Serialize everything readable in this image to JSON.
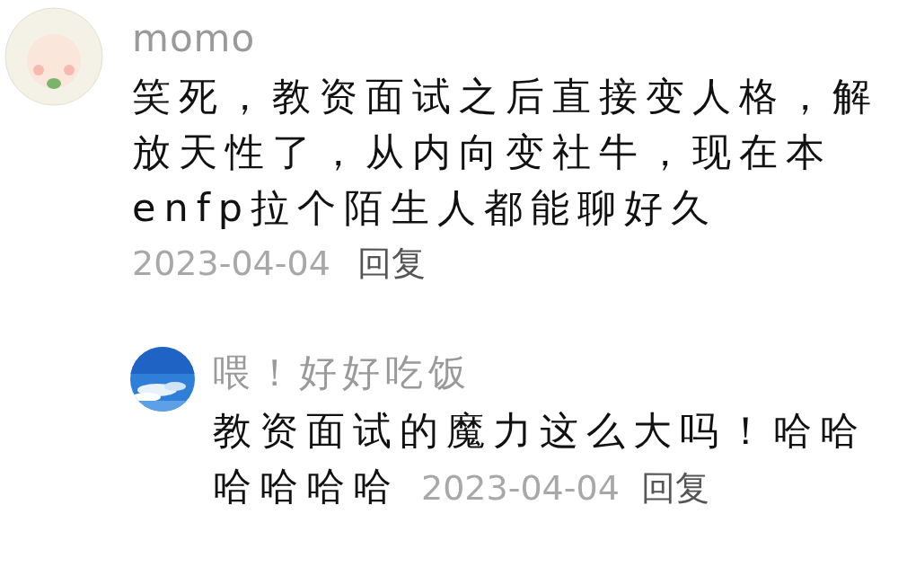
{
  "comment": {
    "author": "momo",
    "text": "笑死，教资面试之后直接变人格，解放天性了，从内向变社牛，现在本enfp拉个陌生人都能聊好久",
    "date": "2023-04-04",
    "reply_link": "回复"
  },
  "reply": {
    "author": "喂！好好吃饭",
    "text_lines": [
      "教资面试的魔力这么大吗！哈哈",
      "哈哈哈哈"
    ],
    "date": "2023-04-04",
    "reply_link": "回复"
  }
}
